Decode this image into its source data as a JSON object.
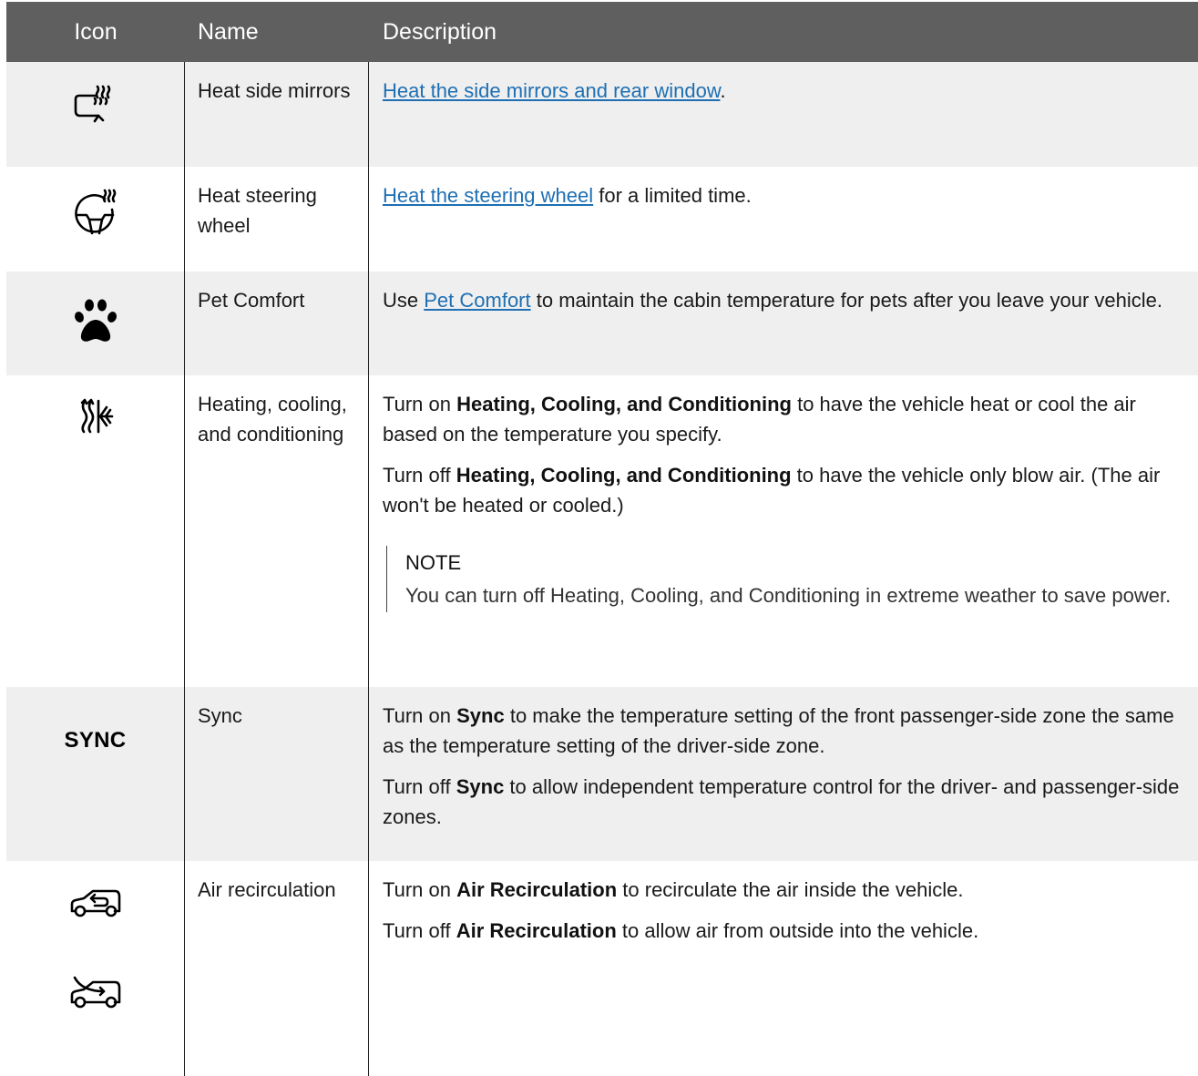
{
  "header": {
    "col_icon": "Icon",
    "col_name": "Name",
    "col_description": "Description"
  },
  "rows": [
    {
      "icon": "heated-mirror-icon",
      "name": "Heat side mirrors",
      "link": "Heat the side mirrors and rear window",
      "after": "."
    },
    {
      "icon": "heated-steering-wheel-icon",
      "name": "Heat steering wheel",
      "link": "Heat the steering wheel",
      "after": " for a limited time."
    },
    {
      "icon": "paw-icon",
      "name": "Pet Comfort",
      "before": "Use ",
      "link": "Pet Comfort",
      "after": " to maintain the cabin temperature for pets after you leave your vehicle."
    },
    {
      "icon": "heat-cool-icon",
      "name": "Heating, cooling, and conditioning",
      "p1_before": "Turn on ",
      "p1_bold": "Heating, Cooling, and Conditioning",
      "p1_after": " to have the vehicle heat or cool the air based on the temperature you specify.",
      "p2_before": "Turn off ",
      "p2_bold": "Heating, Cooling, and Conditioning",
      "p2_after": " to have the vehicle only blow air. (The air won't be heated or cooled.)",
      "note_title": "NOTE",
      "note_body": "You can turn off Heating, Cooling, and Conditioning in extreme weather to save power."
    },
    {
      "icon_text": "SYNC",
      "name": "Sync",
      "p1_before": "Turn on ",
      "p1_bold": "Sync",
      "p1_after": " to make the temperature setting of the front passenger-side zone the same as the temperature setting of the driver-side zone.",
      "p2_before": "Turn off ",
      "p2_bold": "Sync",
      "p2_after": " to allow independent temperature control for the driver- and passenger-side zones."
    },
    {
      "icon": "air-recirculation-icon",
      "icon2": "outside-air-icon",
      "name": "Air recirculation",
      "p1_before": "Turn on ",
      "p1_bold": "Air Recirculation",
      "p1_after": " to recirculate the air inside the vehicle.",
      "p2_before": "Turn off ",
      "p2_bold": "Air Recirculation",
      "p2_after": " to allow air from outside into the vehicle."
    }
  ],
  "colors": {
    "header_bg": "#5f5f5f",
    "row_alt_bg": "#efefef",
    "link": "#1e6fb3"
  }
}
